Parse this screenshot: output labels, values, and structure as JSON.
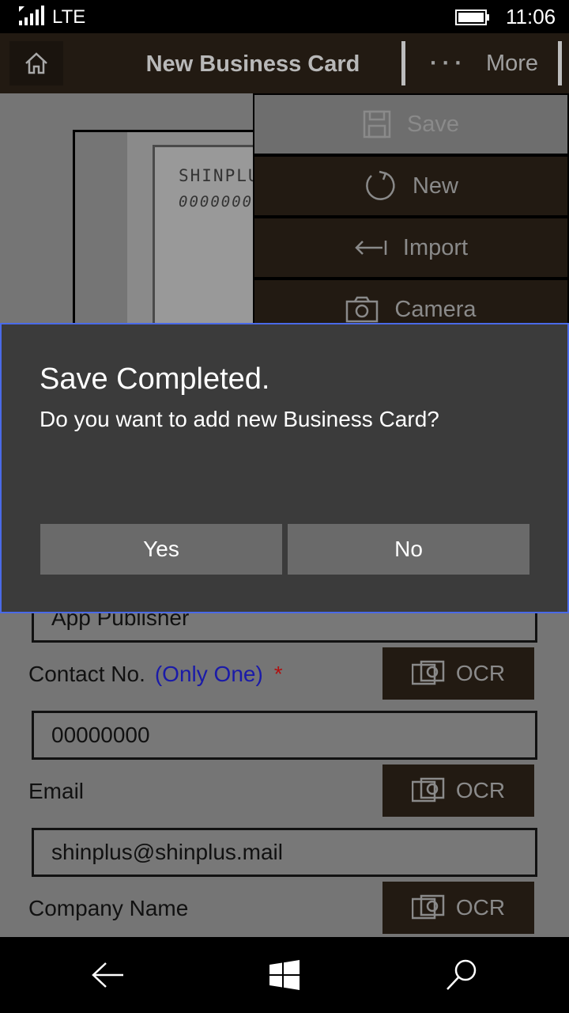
{
  "status_bar": {
    "network": "LTE",
    "time": "11:06"
  },
  "app_bar": {
    "title": "New Business Card",
    "more_dots": "···",
    "more_label": "More"
  },
  "image_preview": {
    "card_text_line1": "SHINPLU",
    "card_text_line2": "0000000"
  },
  "form": {
    "publisher_value": "App Publisher",
    "contact_label": "Contact No.",
    "contact_note": "(Only One)",
    "required_mark": "*",
    "contact_value": "00000000",
    "email_label": "Email",
    "email_value": "shinplus@shinplus.mail",
    "company_label": "Company Name",
    "ocr_label": "OCR"
  },
  "menu": {
    "items": [
      {
        "label": "Save",
        "icon": "save-icon",
        "disabled": true
      },
      {
        "label": "New",
        "icon": "refresh-icon"
      },
      {
        "label": "Import",
        "icon": "import-arrow-icon"
      },
      {
        "label": "Camera",
        "icon": "camera-icon"
      }
    ]
  },
  "dialog": {
    "title": "Save Completed.",
    "message": "Do you want to add new Business Card?",
    "yes_label": "Yes",
    "no_label": "No",
    "accent_color": "#4a6ae8"
  },
  "nav_bar": {
    "icons": [
      "back-arrow-icon",
      "windows-logo-icon",
      "search-icon"
    ]
  }
}
